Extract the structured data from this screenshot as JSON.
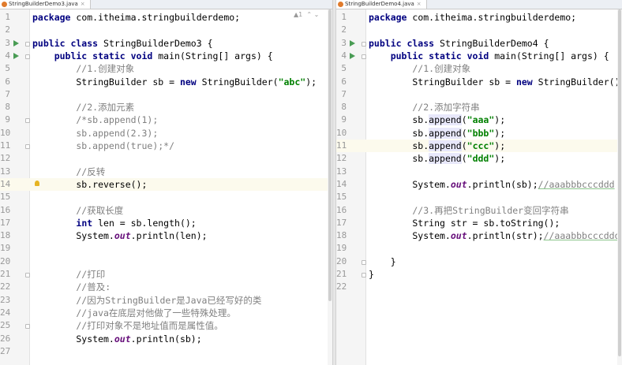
{
  "left_editor": {
    "tab_title": "StringBuilderDemo3.java",
    "inspection": "▲1",
    "lines": [
      {
        "n": "1",
        "tokens": [
          {
            "t": "package ",
            "c": "kw"
          },
          {
            "t": "com.itheima.stringbuilderdemo;",
            "c": ""
          }
        ]
      },
      {
        "n": "2",
        "tokens": []
      },
      {
        "n": "3",
        "run": true,
        "fold": true,
        "tokens": [
          {
            "t": "public class ",
            "c": "kw"
          },
          {
            "t": "StringBuilderDemo3 {",
            "c": ""
          }
        ]
      },
      {
        "n": "4",
        "run": true,
        "fold": true,
        "tokens": [
          {
            "t": "    public static void ",
            "c": "kw"
          },
          {
            "t": "main(String[] args) {",
            "c": ""
          }
        ]
      },
      {
        "n": "5",
        "tokens": [
          {
            "t": "        //1.创建对象",
            "c": "cmg"
          }
        ]
      },
      {
        "n": "6",
        "tokens": [
          {
            "t": "        StringBuilder sb = ",
            "c": ""
          },
          {
            "t": "new ",
            "c": "kw"
          },
          {
            "t": "StringBuilder(",
            "c": ""
          },
          {
            "t": "\"abc\"",
            "c": "str"
          },
          {
            "t": ");",
            "c": ""
          }
        ]
      },
      {
        "n": "7",
        "tokens": []
      },
      {
        "n": "8",
        "tokens": [
          {
            "t": "        //2.添加元素",
            "c": "cmg"
          }
        ]
      },
      {
        "n": "9",
        "fold": true,
        "tokens": [
          {
            "t": "        /*sb.append(1);",
            "c": "cmg"
          }
        ]
      },
      {
        "n": "10",
        "tokens": [
          {
            "t": "        sb.append(2.3);",
            "c": "cmg"
          }
        ]
      },
      {
        "n": "11",
        "fold": true,
        "tokens": [
          {
            "t": "        sb.append(true);*/",
            "c": "cmg"
          }
        ]
      },
      {
        "n": "12",
        "tokens": []
      },
      {
        "n": "13",
        "tokens": [
          {
            "t": "        //反转",
            "c": "cmg"
          }
        ]
      },
      {
        "n": "14",
        "hl": true,
        "bulb": true,
        "tokens": [
          {
            "t": "        sb.reverse();",
            "c": ""
          }
        ]
      },
      {
        "n": "15",
        "tokens": []
      },
      {
        "n": "16",
        "tokens": [
          {
            "t": "        //获取长度",
            "c": "cmg"
          }
        ]
      },
      {
        "n": "17",
        "tokens": [
          {
            "t": "        ",
            "c": ""
          },
          {
            "t": "int ",
            "c": "kw"
          },
          {
            "t": "len = sb.length();",
            "c": ""
          }
        ]
      },
      {
        "n": "18",
        "tokens": [
          {
            "t": "        System.",
            "c": ""
          },
          {
            "t": "out",
            "c": "fld"
          },
          {
            "t": ".println(len);",
            "c": ""
          }
        ]
      },
      {
        "n": "19",
        "tokens": []
      },
      {
        "n": "20",
        "tokens": []
      },
      {
        "n": "21",
        "fold": true,
        "tokens": [
          {
            "t": "        //打印",
            "c": "cmg"
          }
        ]
      },
      {
        "n": "22",
        "tokens": [
          {
            "t": "        //普及:",
            "c": "cmg"
          }
        ]
      },
      {
        "n": "23",
        "tokens": [
          {
            "t": "        //因为StringBuilder是Java已经写好的类",
            "c": "cmg"
          }
        ]
      },
      {
        "n": "24",
        "tokens": [
          {
            "t": "        //java在底层对他做了一些特殊处理。",
            "c": "cmg"
          }
        ]
      },
      {
        "n": "25",
        "fold": true,
        "tokens": [
          {
            "t": "        //打印对象不是地址值而是属性值。",
            "c": "cmg"
          }
        ]
      },
      {
        "n": "26",
        "tokens": [
          {
            "t": "        System.",
            "c": ""
          },
          {
            "t": "out",
            "c": "fld"
          },
          {
            "t": ".println(sb);",
            "c": ""
          }
        ]
      },
      {
        "n": "27",
        "tokens": []
      }
    ]
  },
  "right_editor": {
    "tab_title": "StringBuilderDemo4.java",
    "lines": [
      {
        "n": "1",
        "tokens": [
          {
            "t": "package ",
            "c": "kw"
          },
          {
            "t": "com.itheima.stringbuilderdemo;",
            "c": ""
          }
        ]
      },
      {
        "n": "2",
        "tokens": []
      },
      {
        "n": "3",
        "run": true,
        "fold": true,
        "tokens": [
          {
            "t": "public class ",
            "c": "kw"
          },
          {
            "t": "StringBuilderDemo4 {",
            "c": ""
          }
        ]
      },
      {
        "n": "4",
        "run": true,
        "fold": true,
        "tokens": [
          {
            "t": "    public static void ",
            "c": "kw"
          },
          {
            "t": "main(String[] args) {",
            "c": ""
          }
        ]
      },
      {
        "n": "5",
        "tokens": [
          {
            "t": "        //1.创建对象",
            "c": "cmg"
          }
        ]
      },
      {
        "n": "6",
        "tokens": [
          {
            "t": "        StringBuilder sb = ",
            "c": ""
          },
          {
            "t": "new ",
            "c": "kw"
          },
          {
            "t": "StringBuilder();",
            "c": ""
          }
        ]
      },
      {
        "n": "7",
        "tokens": []
      },
      {
        "n": "8",
        "tokens": [
          {
            "t": "        //2.添加字符串",
            "c": "cmg"
          }
        ]
      },
      {
        "n": "9",
        "tokens": [
          {
            "t": "        sb.",
            "c": ""
          },
          {
            "t": "append",
            "c": "am"
          },
          {
            "t": "(",
            "c": ""
          },
          {
            "t": "\"aaa\"",
            "c": "str"
          },
          {
            "t": ");",
            "c": ""
          }
        ]
      },
      {
        "n": "10",
        "tokens": [
          {
            "t": "        sb.",
            "c": ""
          },
          {
            "t": "append",
            "c": "am"
          },
          {
            "t": "(",
            "c": ""
          },
          {
            "t": "\"bbb\"",
            "c": "str"
          },
          {
            "t": ");",
            "c": ""
          }
        ]
      },
      {
        "n": "11",
        "hl": true,
        "tokens": [
          {
            "t": "        sb.",
            "c": ""
          },
          {
            "t": "append",
            "c": "am"
          },
          {
            "t": "(",
            "c": ""
          },
          {
            "t": "\"ccc\"",
            "c": "str"
          },
          {
            "t": ");",
            "c": ""
          }
        ]
      },
      {
        "n": "12",
        "tokens": [
          {
            "t": "        sb.",
            "c": ""
          },
          {
            "t": "append",
            "c": "am"
          },
          {
            "t": "(",
            "c": ""
          },
          {
            "t": "\"ddd\"",
            "c": "str"
          },
          {
            "t": ");",
            "c": ""
          }
        ]
      },
      {
        "n": "13",
        "tokens": []
      },
      {
        "n": "14",
        "tokens": [
          {
            "t": "        System.",
            "c": ""
          },
          {
            "t": "out",
            "c": "fld"
          },
          {
            "t": ".println(sb);",
            "c": ""
          },
          {
            "t": "//aaabbbcccddd",
            "c": "cmt"
          }
        ]
      },
      {
        "n": "15",
        "tokens": []
      },
      {
        "n": "16",
        "tokens": [
          {
            "t": "        //3.再把StringBuilder变回字符串",
            "c": "cmg"
          }
        ]
      },
      {
        "n": "17",
        "tokens": [
          {
            "t": "        String str = sb.toString();",
            "c": ""
          }
        ]
      },
      {
        "n": "18",
        "tokens": [
          {
            "t": "        System.",
            "c": ""
          },
          {
            "t": "out",
            "c": "fld"
          },
          {
            "t": ".println(str);",
            "c": ""
          },
          {
            "t": "//aaabbbcccddd",
            "c": "cmt"
          }
        ]
      },
      {
        "n": "19",
        "tokens": []
      },
      {
        "n": "20",
        "fold": true,
        "tokens": [
          {
            "t": "    }",
            "c": ""
          }
        ]
      },
      {
        "n": "21",
        "fold": true,
        "tokens": [
          {
            "t": "}",
            "c": ""
          }
        ]
      },
      {
        "n": "22",
        "tokens": []
      }
    ]
  },
  "colors": {
    "keyword": "#000080",
    "string": "#008000",
    "comment": "#808080",
    "field": "#660e7a",
    "current_line": "#fcfaed",
    "run_icon": "#499c54"
  }
}
